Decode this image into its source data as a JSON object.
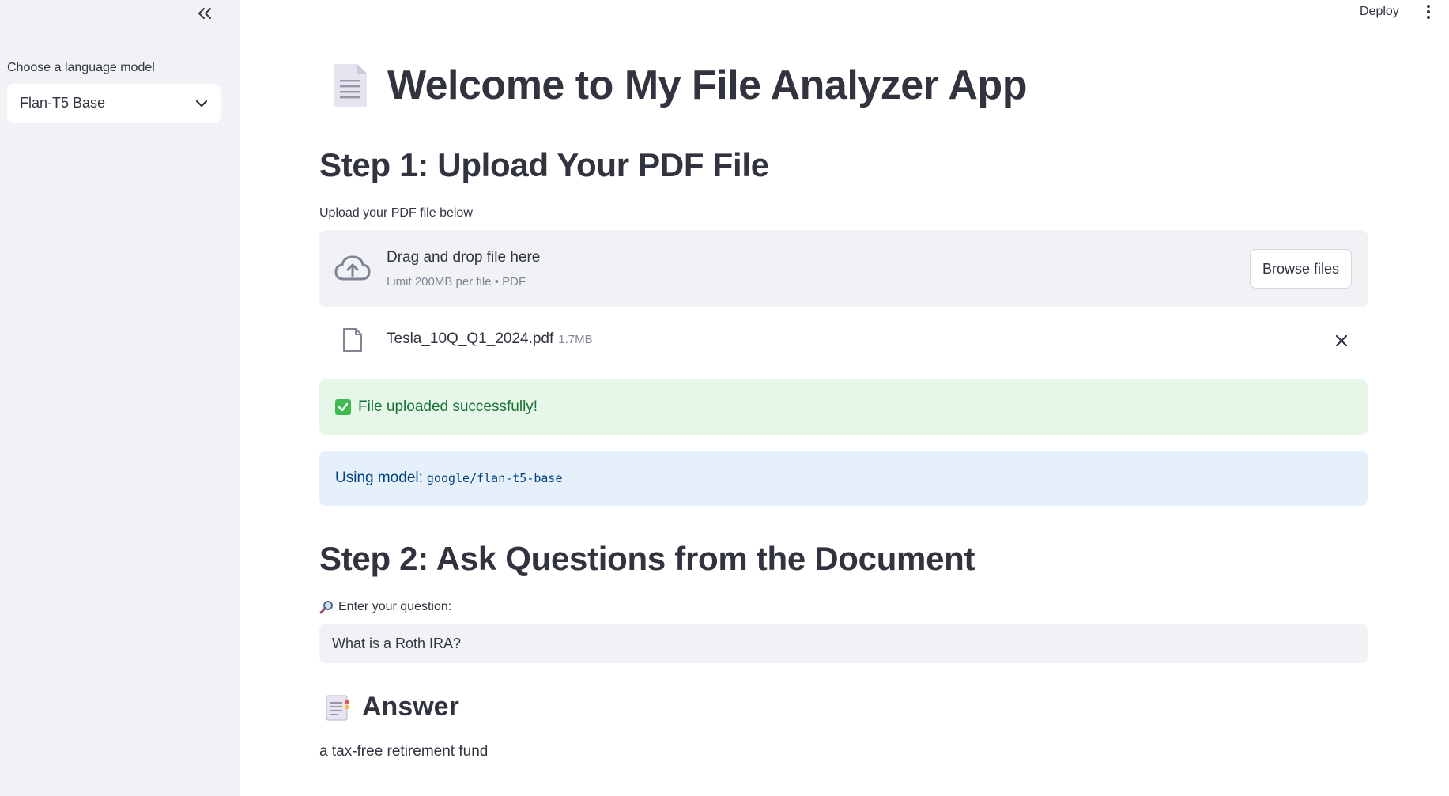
{
  "sidebar": {
    "collapse_icon": "double-chevron-left-icon",
    "model_label": "Choose a language model",
    "model_selected": "Flan-T5 Base",
    "select_icon": "chevron-down-icon"
  },
  "header": {
    "deploy_label": "Deploy",
    "menu_icon": "vertical-dots-icon"
  },
  "main": {
    "title": "Welcome to My File Analyzer App",
    "title_icon": "page-document-emoji",
    "step1_heading": "Step 1: Upload Your PDF File",
    "upload_label": "Upload your PDF file below",
    "dropzone": {
      "title": "Drag and drop file here",
      "limit": "Limit 200MB per file • PDF",
      "browse_label": "Browse files"
    },
    "uploaded_file": {
      "name": "Tesla_10Q_Q1_2024.pdf",
      "size": "1.7MB"
    },
    "success_message": "File uploaded successfully!",
    "info_prefix": "Using model:",
    "info_model": "google/flan-t5-base",
    "step2_heading": "Step 2: Ask Questions from the Document",
    "question_label": "Enter your question:",
    "question_value": "What is a Roth IRA?",
    "answer_heading": "Answer",
    "answer_text": "a tax-free retirement fund"
  },
  "colors": {
    "sidebar_bg": "#f0f2f6",
    "success_bg": "#e6f7ea",
    "success_text": "#177233",
    "info_bg": "#e6f0fa",
    "info_text": "#004280",
    "text": "#31333f"
  }
}
